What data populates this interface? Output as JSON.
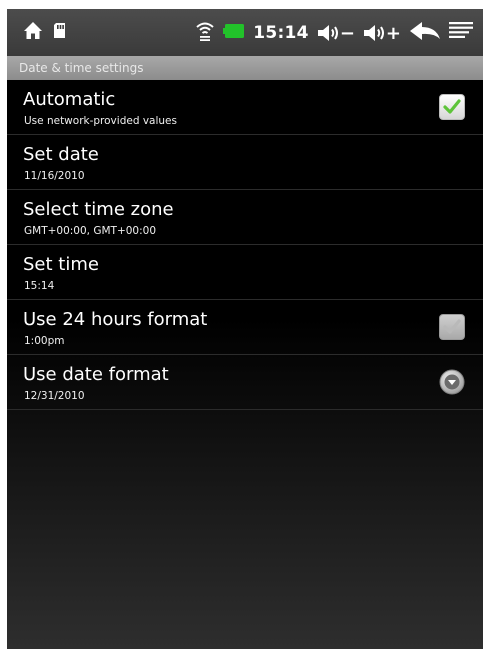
{
  "status_bar": {
    "time": "15:14",
    "volume_down_label": "−",
    "volume_up_label": "+",
    "icons": [
      "home-icon",
      "sd-card-icon",
      "wifi-icon",
      "battery-icon",
      "volume-down-icon",
      "volume-up-icon",
      "back-icon",
      "menu-icon"
    ],
    "battery_color": "#22c22a"
  },
  "screen_title": "Date & time settings",
  "settings": [
    {
      "title": "Automatic",
      "summary": "Use network-provided values",
      "control": "checkbox",
      "checked": true,
      "enabled": true
    },
    {
      "title": "Set date",
      "summary": "11/16/2010",
      "control": "none"
    },
    {
      "title": "Select time zone",
      "summary": "GMT+00:00, GMT+00:00",
      "control": "none"
    },
    {
      "title": "Set time",
      "summary": "15:14",
      "control": "none"
    },
    {
      "title": "Use 24 hours format",
      "summary": "1:00pm",
      "control": "checkbox",
      "checked": true,
      "enabled": false
    },
    {
      "title": "Use date format",
      "summary": "12/31/2010",
      "control": "dropdown"
    }
  ],
  "colors": {
    "check_green": "#5ec43a",
    "status_bar_bg": "#444444",
    "title_bar_bg": "#9a9a9a"
  }
}
